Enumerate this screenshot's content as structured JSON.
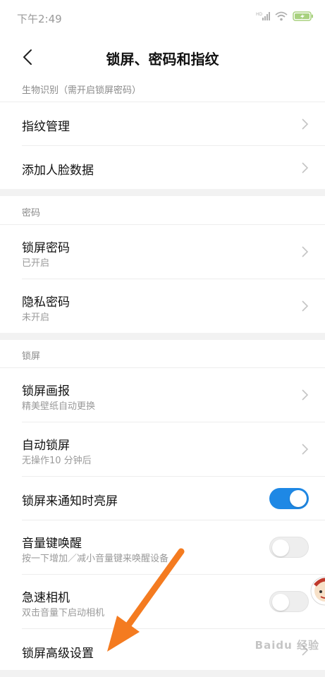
{
  "status_bar": {
    "time": "下午2:49",
    "icons": [
      "hd-signal-icon",
      "wifi-icon",
      "battery-charging-icon"
    ]
  },
  "header": {
    "title": "锁屏、密码和指纹",
    "back_icon": "back-arrow-icon"
  },
  "sections": {
    "biometrics": {
      "title": "生物识别（需开启锁屏密码）",
      "items": [
        {
          "label": "指纹管理"
        },
        {
          "label": "添加人脸数据"
        }
      ]
    },
    "password": {
      "title": "密码",
      "items": [
        {
          "label": "锁屏密码",
          "sub": "已开启"
        },
        {
          "label": "隐私密码",
          "sub": "未开启"
        }
      ]
    },
    "lockscreen": {
      "title": "锁屏",
      "items": [
        {
          "label": "锁屏画报",
          "sub": "精美壁纸自动更换"
        },
        {
          "label": "自动锁屏",
          "sub": "无操作10 分钟后"
        },
        {
          "label": "锁屏来通知时亮屏",
          "toggle": true
        },
        {
          "label": "音量键唤醒",
          "sub": "按一下增加／减小音量键来唤醒设备",
          "toggle": false
        },
        {
          "label": "急速相机",
          "sub": "双击音量下启动相机",
          "toggle": false
        },
        {
          "label": "锁屏高级设置"
        }
      ]
    }
  },
  "colors": {
    "accent": "#1e88e5",
    "annotation_arrow": "#f47b20"
  },
  "watermark": "Baidu 经验"
}
